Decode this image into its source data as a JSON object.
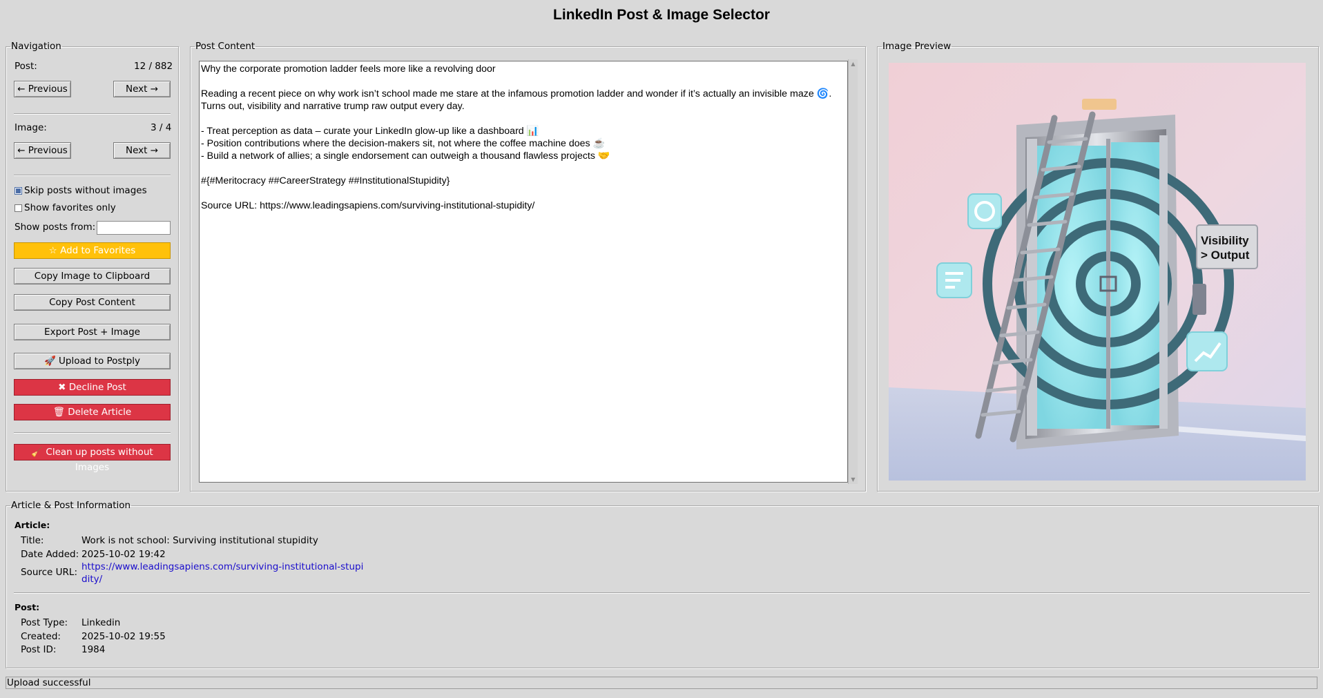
{
  "window": {
    "title": "LinkedIn Post & Image Selector"
  },
  "navigation": {
    "legend": "Navigation",
    "post_label": "Post:",
    "post_counter": "12 / 882",
    "image_label": "Image:",
    "image_counter": "3 / 4",
    "prev_label": "← Previous",
    "next_label": "Next →",
    "skip_label": "Skip posts without images",
    "skip_checked": true,
    "favorites_only_label": "Show favorites only",
    "favorites_only_checked": false,
    "show_from_label": "Show posts from:",
    "show_from_value": "",
    "buttons": {
      "add_favorites": "☆ Add to Favorites",
      "copy_image": "Copy Image to Clipboard",
      "copy_post": "Copy Post Content",
      "export": "Export Post + Image",
      "upload": "🚀 Upload to Postply",
      "decline": "✖ Decline Post",
      "delete": "🗑 Delete Article",
      "cleanup": "🧹 Clean up posts without Images"
    }
  },
  "post_content": {
    "legend": "Post Content",
    "lines": [
      "Why the corporate promotion ladder feels more like a revolving door",
      "",
      "Reading a recent piece on why work isn’t school made me stare at the infamous promotion ladder and wonder if it’s actually an invisible maze 🌀.",
      "Turns out, visibility and narrative trump raw output every day.",
      "",
      "- Treat perception as data – curate your LinkedIn glow-up like a dashboard 📊",
      "- Position contributions where the decision-makers sit, not where the coffee machine does ☕",
      "- Build a network of allies; a single endorsement can outweigh a thousand flawless projects 🤝",
      "",
      "#{#Meritocracy ##CareerStrategy ##InstitutionalStupidity}",
      "",
      "Source URL: https://www.leadingsapiens.com/surviving-institutional-stupidity/"
    ]
  },
  "image_preview": {
    "legend": "Image Preview",
    "sign_text": "Visibility\n> Output"
  },
  "info": {
    "legend": "Article & Post Information",
    "article_heading": "Article:",
    "title_label": "Title:",
    "title_value": "Work is not school: Surviving institutional stupidity",
    "date_added_label": "Date Added:",
    "date_added_value": "2025-10-02 19:42",
    "source_url_label": "Source URL:",
    "source_url_line1": "https://www.leadingsapiens.com/surviving-institutional-stupi",
    "source_url_line2": "dity/",
    "post_heading": "Post:",
    "post_type_label": "Post Type:",
    "post_type_value": "Linkedin",
    "created_label": "Created:",
    "created_value": "2025-10-02 19:55",
    "post_id_label": "Post ID:",
    "post_id_value": "1984"
  },
  "status": {
    "text": "Upload successful"
  },
  "colors": {
    "favorites": "#ffc10a",
    "danger": "#dc3545",
    "link": "#1a0dcc"
  }
}
